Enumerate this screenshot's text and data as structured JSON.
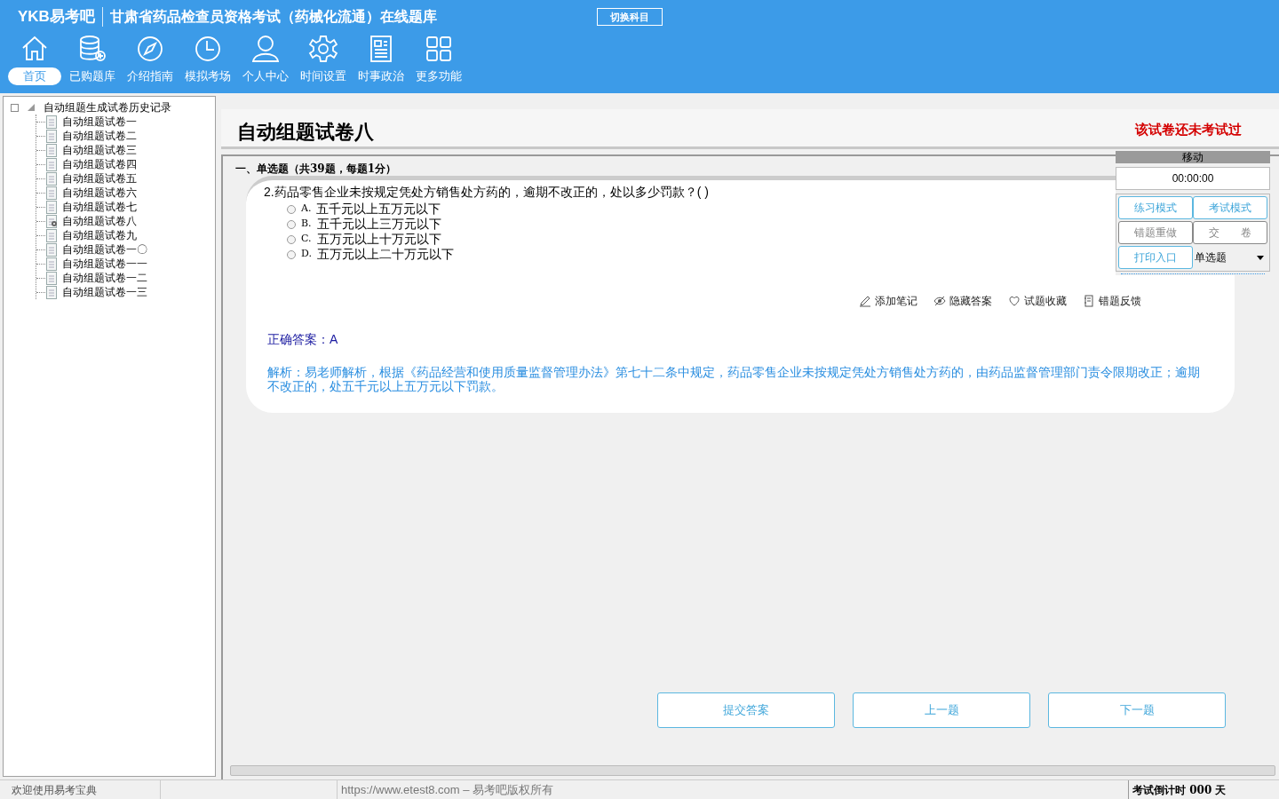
{
  "header": {
    "logo": "YKB易考吧",
    "title": "甘肃省药品检查员资格考试（药械化流通）在线题库",
    "switch_button": "切换科目",
    "nav": [
      {
        "label": "首页",
        "selected": true
      },
      {
        "label": "已购题库",
        "selected": false
      },
      {
        "label": "介绍指南",
        "selected": false
      },
      {
        "label": "模拟考场",
        "selected": false
      },
      {
        "label": "个人中心",
        "selected": false
      },
      {
        "label": "时间设置",
        "selected": false
      },
      {
        "label": "时事政治",
        "selected": false
      },
      {
        "label": "更多功能",
        "selected": false
      }
    ]
  },
  "tree": {
    "label": "自动组题生成试卷历史记录",
    "expanded": true,
    "children": [
      {
        "label": "自动组题试卷一",
        "selected": false
      },
      {
        "label": "自动组题试卷二",
        "selected": false
      },
      {
        "label": "自动组题试卷三",
        "selected": false
      },
      {
        "label": "自动组题试卷四",
        "selected": false
      },
      {
        "label": "自动组题试卷五",
        "selected": false
      },
      {
        "label": "自动组题试卷六",
        "selected": false
      },
      {
        "label": "自动组题试卷七",
        "selected": false
      },
      {
        "label": "自动组题试卷八",
        "selected": true
      },
      {
        "label": "自动组题试卷九",
        "selected": false
      },
      {
        "label": "自动组题试卷一〇",
        "selected": false
      },
      {
        "label": "自动组题试卷一一",
        "selected": false
      },
      {
        "label": "自动组题试卷一二",
        "selected": false
      },
      {
        "label": "自动组题试卷一三",
        "selected": false
      }
    ]
  },
  "paper": {
    "title": "自动组题试卷八",
    "status_note": "该试卷还未考试过",
    "section_heading": "一、单选题（共39题，每题1分）",
    "question": "2.药品零售企业未按规定凭处方销售处方药的，逾期不改正的，处以多少罚款？( )",
    "options": [
      {
        "letter": "A.",
        "text": "五千元以上五万元以下",
        "selected": false
      },
      {
        "letter": "B.",
        "text": "五千元以上三万元以下",
        "selected": false
      },
      {
        "letter": "C.",
        "text": "五万元以上十万元以下",
        "selected": false
      },
      {
        "letter": "D.",
        "text": "五万元以上二十万元以下",
        "selected": false
      }
    ],
    "tools": [
      "添加笔记",
      "隐藏答案",
      "试题收藏",
      "错题反馈"
    ],
    "correct_answer": "正确答案：A",
    "analysis": "解析：易老师解析，根据《药品经营和使用质量监督管理办法》第七十二条中规定，药品零售企业未按规定凭处方销售处方药的，由药品监督管理部门责令限期改正；逾期不改正的，处五千元以上五万元以下罚款。"
  },
  "side_panel": {
    "header": "移动",
    "timer": "00:00:00",
    "buttons": [
      {
        "label": "练习模式",
        "disabled": false
      },
      {
        "label": "考试模式",
        "disabled": false
      },
      {
        "label": "错题重做",
        "disabled": true
      },
      {
        "label": "交　　卷",
        "disabled": true
      },
      {
        "label": "打印入口",
        "disabled": false
      }
    ],
    "dropdown": "单选题"
  },
  "bottom_buttons": [
    "提交答案",
    "上一题",
    "下一题"
  ],
  "status_bar": {
    "welcome": "欢迎使用易考宝典",
    "copyright": "https://www.etest8.com – 易考吧版权所有",
    "countdown": "考试倒计时 000 天"
  }
}
